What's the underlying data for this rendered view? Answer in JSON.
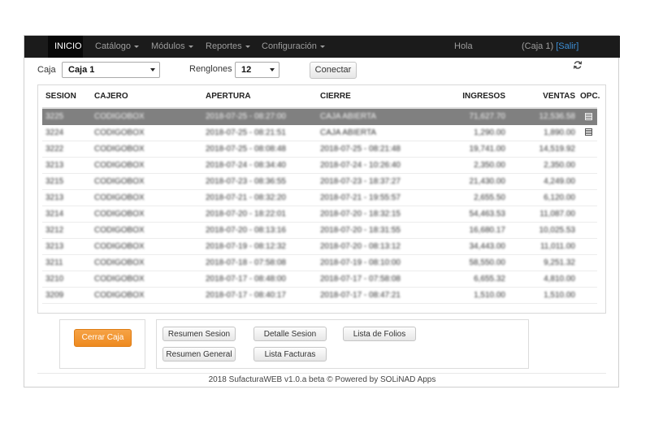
{
  "nav": {
    "items": [
      {
        "label": "INICIO"
      },
      {
        "label": "Catálogo"
      },
      {
        "label": "Módulos"
      },
      {
        "label": "Reportes"
      },
      {
        "label": "Configuración"
      }
    ],
    "greeting": "Hola",
    "session_label": "(Caja 1)",
    "logout_label": "[Salir]"
  },
  "toolbar": {
    "caja_label": "Caja",
    "caja_value": "Caja 1",
    "renglones_label": "Renglones",
    "renglones_value": "12",
    "connect_label": "Conectar",
    "refresh_icon": "refresh-icon"
  },
  "table": {
    "headers": [
      "SESION",
      "CAJERO",
      "APERTURA",
      "CIERRE",
      "INGRESOS",
      "VENTAS",
      "OPC."
    ],
    "rows": [
      {
        "sesion": "3225",
        "cajero": "CODIGOBOX",
        "apertura": "2018-07-25 - 08:27:00",
        "cierre": "CAJA ABIERTA",
        "ingresos": "71,627.70",
        "ventas": "12,536.58",
        "opc": true
      },
      {
        "sesion": "3224",
        "cajero": "CODIGOBOX",
        "apertura": "2018-07-25 - 08:21:51",
        "cierre": "CAJA ABIERTA",
        "ingresos": "1,290.00",
        "ventas": "1,890.00",
        "opc": true
      },
      {
        "sesion": "3222",
        "cajero": "CODIGOBOX",
        "apertura": "2018-07-25 - 08:08:48",
        "cierre": "2018-07-25 - 08:21:48",
        "ingresos": "19,741.00",
        "ventas": "14,519.92",
        "opc": false
      },
      {
        "sesion": "3213",
        "cajero": "CODIGOBOX",
        "apertura": "2018-07-24 - 08:34:40",
        "cierre": "2018-07-24 - 10:26:40",
        "ingresos": "2,350.00",
        "ventas": "2,350.00",
        "opc": false
      },
      {
        "sesion": "3215",
        "cajero": "CODIGOBOX",
        "apertura": "2018-07-23 - 08:36:55",
        "cierre": "2018-07-23 - 18:37:27",
        "ingresos": "21,430.00",
        "ventas": "4,249.00",
        "opc": false
      },
      {
        "sesion": "3213",
        "cajero": "CODIGOBOX",
        "apertura": "2018-07-21 - 08:32:20",
        "cierre": "2018-07-21 - 19:55:57",
        "ingresos": "2,655.50",
        "ventas": "6,120.00",
        "opc": false
      },
      {
        "sesion": "3214",
        "cajero": "CODIGOBOX",
        "apertura": "2018-07-20 - 18:22:01",
        "cierre": "2018-07-20 - 18:32:15",
        "ingresos": "54,463.53",
        "ventas": "11,087.00",
        "opc": false
      },
      {
        "sesion": "3212",
        "cajero": "CODIGOBOX",
        "apertura": "2018-07-20 - 08:13:16",
        "cierre": "2018-07-20 - 18:31:55",
        "ingresos": "16,680.17",
        "ventas": "10,025.53",
        "opc": false
      },
      {
        "sesion": "3213",
        "cajero": "CODIGOBOX",
        "apertura": "2018-07-19 - 08:12:32",
        "cierre": "2018-07-20 - 08:13:12",
        "ingresos": "34,443.00",
        "ventas": "11,011.00",
        "opc": false
      },
      {
        "sesion": "3211",
        "cajero": "CODIGOBOX",
        "apertura": "2018-07-18 - 07:58:08",
        "cierre": "2018-07-19 - 08:10:00",
        "ingresos": "58,550.00",
        "ventas": "9,251.32",
        "opc": false
      },
      {
        "sesion": "3210",
        "cajero": "CODIGOBOX",
        "apertura": "2018-07-17 - 08:48:00",
        "cierre": "2018-07-17 - 07:58:08",
        "ingresos": "6,655.32",
        "ventas": "4,810.00",
        "opc": false
      },
      {
        "sesion": "3209",
        "cajero": "CODIGOBOX",
        "apertura": "2018-07-17 - 08:40:17",
        "cierre": "2018-07-17 - 08:47:21",
        "ingresos": "1,510.00",
        "ventas": "1,510.00",
        "opc": false
      }
    ]
  },
  "actions": {
    "close_register": "Cerrar Caja",
    "resumen_sesion": "Resumen Sesion",
    "detalle_sesion": "Detalle Sesion",
    "lista_folios": "Lista de Folios",
    "resumen_general": "Resumen General",
    "lista_facturas": "Lista Facturas"
  },
  "footer": {
    "text": "2018 SufacturaWEB v1.0.a beta © Powered by SOLiNAD Apps"
  },
  "colors": {
    "navbar": "#1b1b1b",
    "accent_orange": "#ee8a1f",
    "selected_row": "#808080",
    "link_blue": "#3d8fd6"
  }
}
